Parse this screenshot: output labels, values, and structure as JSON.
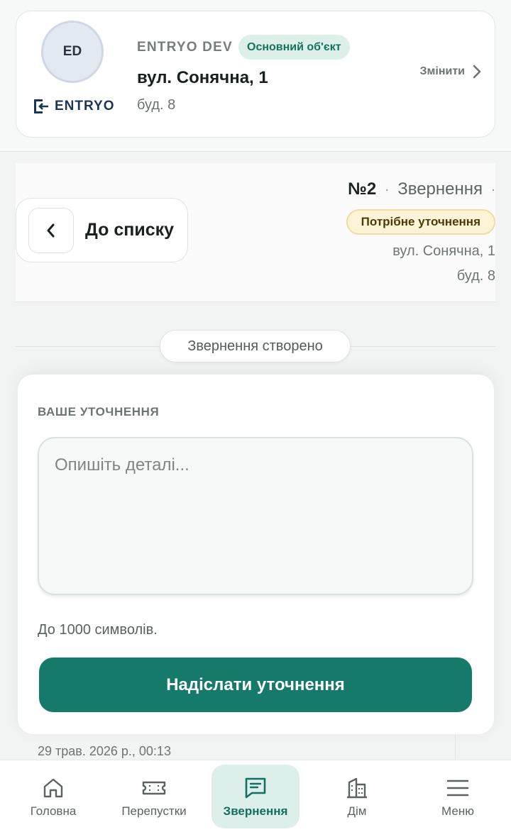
{
  "object_card": {
    "avatar_initials": "ED",
    "brand_name": "ENTRYO",
    "org_name": "ENTRYO DEV",
    "primary_badge": "Основний об'єкт",
    "street": "вул. Сонячна, 1",
    "building": "буд. 8",
    "change_label": "Змінити"
  },
  "ticket": {
    "back_label": "До списку",
    "number": "№2",
    "type": "Звернення",
    "status": "Потрібне уточнення",
    "street": "вул. Сонячна, 1",
    "building": "буд. 8"
  },
  "timeline": {
    "event_label": "Звернення створено",
    "message_time": "29 трав. 2026 р., 00:13"
  },
  "clarification": {
    "title": "ВАШЕ УТОЧНЕННЯ",
    "placeholder": "Опишіть деталі...",
    "value": "",
    "hint": "До 1000 символів.",
    "submit_label": "Надіслати уточнення"
  },
  "bottom_nav": {
    "items": [
      {
        "label": "Головна",
        "icon": "home-icon",
        "active": false
      },
      {
        "label": "Перепустки",
        "icon": "ticket-icon",
        "active": false
      },
      {
        "label": "Звернення",
        "icon": "message-icon",
        "active": true
      },
      {
        "label": "Дім",
        "icon": "building-icon",
        "active": false
      },
      {
        "label": "Меню",
        "icon": "menu-icon",
        "active": false
      }
    ]
  },
  "colors": {
    "accent": "#167a6a",
    "status_badge_bg": "#fdf4d8",
    "primary_badge_bg": "#dcefe9"
  }
}
